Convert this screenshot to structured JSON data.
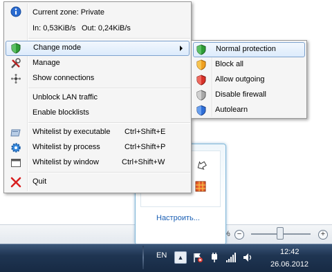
{
  "menu": {
    "zone_label": "Current zone: Private",
    "traffic_in": "In: 0,53KiB/s",
    "traffic_out": "Out: 0,24KiB/s",
    "items": [
      {
        "label": "Change mode",
        "icon": "shield-green-icon"
      },
      {
        "label": "Manage",
        "icon": "tools-icon"
      },
      {
        "label": "Show connections",
        "icon": "connections-icon"
      },
      {
        "label": "Unblock LAN traffic"
      },
      {
        "label": "Enable blocklists"
      },
      {
        "label": "Whitelist by executable",
        "shortcut": "Ctrl+Shift+E",
        "icon": "executable-icon"
      },
      {
        "label": "Whitelist by process",
        "shortcut": "Ctrl+Shift+P",
        "icon": "gear-icon"
      },
      {
        "label": "Whitelist by window",
        "shortcut": "Ctrl+Shift+W",
        "icon": "window-icon"
      },
      {
        "label": "Quit",
        "icon": "close-icon"
      }
    ]
  },
  "submenu": {
    "items": [
      {
        "label": "Normal protection",
        "icon": "shield-green-icon",
        "color": "#2e9d36"
      },
      {
        "label": "Block all",
        "icon": "shield-orange-icon",
        "color": "#f0a020"
      },
      {
        "label": "Allow outgoing",
        "icon": "shield-red-icon",
        "color": "#d8322a"
      },
      {
        "label": "Disable firewall",
        "icon": "shield-grey-icon",
        "color": "#a8a8a8"
      },
      {
        "label": "Autolearn",
        "icon": "shield-blue-icon",
        "color": "#2f6fd8"
      }
    ]
  },
  "flyout": {
    "customize_label": "Настроить..."
  },
  "statusbar": {
    "zoom_suffix": "%",
    "zoom_minus": "−",
    "zoom_plus": "+"
  },
  "taskbar": {
    "language": "EN",
    "time": "12:42",
    "date": "26.06.2012"
  }
}
